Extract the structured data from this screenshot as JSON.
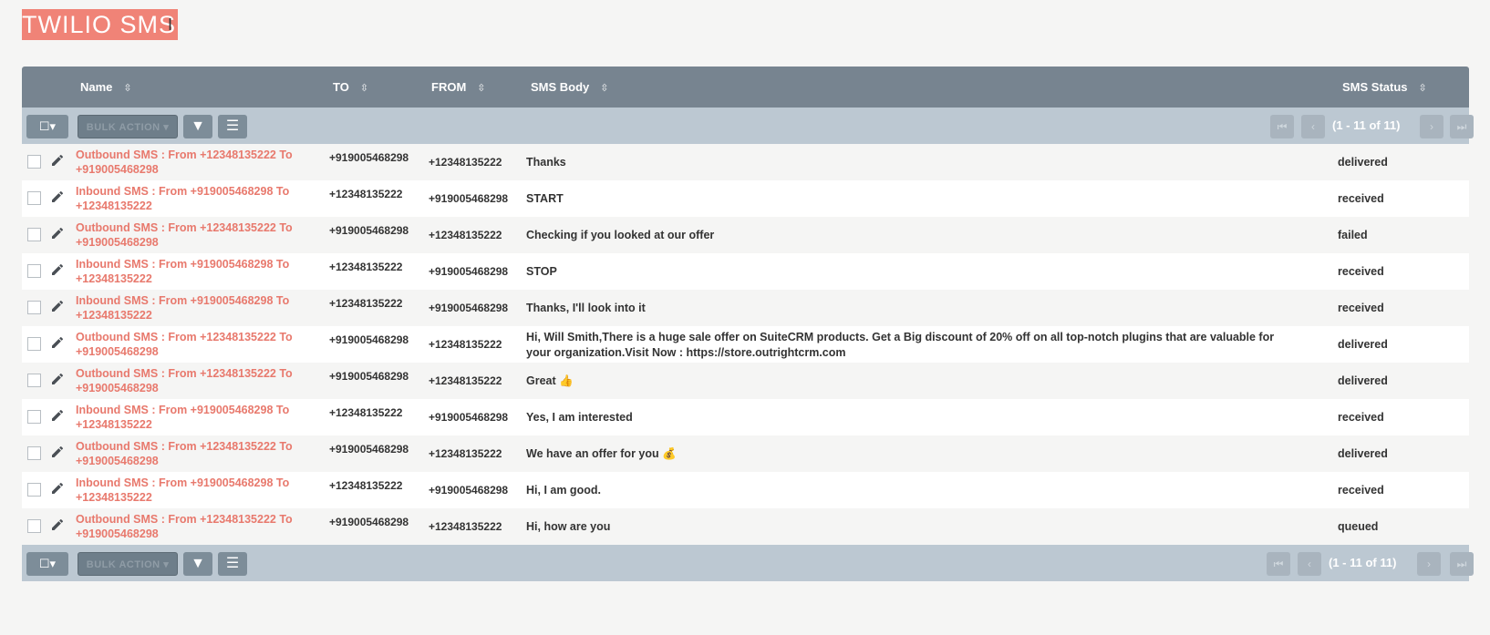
{
  "title": "TWILIO SMS",
  "columns": {
    "name": "Name",
    "to": "TO",
    "from": "FROM",
    "body": "SMS Body",
    "status": "SMS Status"
  },
  "toolbar": {
    "bulk_action": "BULK ACTION",
    "pagination": "(1 - 11 of 11)"
  },
  "rows": [
    {
      "name": "Outbound SMS : From +12348135222 To +919005468298",
      "to": "+919005468298",
      "from": "+12348135222",
      "body": "Thanks",
      "status": "delivered"
    },
    {
      "name": "Inbound SMS : From +919005468298 To +12348135222",
      "to": "+12348135222",
      "from": "+919005468298",
      "body": "START",
      "status": "received"
    },
    {
      "name": "Outbound SMS : From +12348135222 To +919005468298",
      "to": "+919005468298",
      "from": "+12348135222",
      "body": "Checking if you looked at our offer",
      "status": "failed"
    },
    {
      "name": "Inbound SMS : From +919005468298 To +12348135222",
      "to": "+12348135222",
      "from": "+919005468298",
      "body": "STOP",
      "status": "received"
    },
    {
      "name": "Inbound SMS : From +919005468298 To +12348135222",
      "to": "+12348135222",
      "from": "+919005468298",
      "body": "Thanks, I'll look into it",
      "status": "received"
    },
    {
      "name": "Outbound SMS : From +12348135222 To +919005468298",
      "to": "+919005468298",
      "from": "+12348135222",
      "body": "Hi, Will Smith,There is a huge sale offer on SuiteCRM products. Get a Big discount of 20% off on all top-notch plugins that are valuable for your organization.Visit Now : https://store.outrightcrm.com",
      "status": "delivered"
    },
    {
      "name": "Outbound SMS : From +12348135222 To +919005468298",
      "to": "+919005468298",
      "from": "+12348135222",
      "body": "Great 👍",
      "status": "delivered"
    },
    {
      "name": "Inbound SMS : From +919005468298 To +12348135222",
      "to": "+12348135222",
      "from": "+919005468298",
      "body": "Yes, I am interested",
      "status": "received"
    },
    {
      "name": "Outbound SMS : From +12348135222 To +919005468298",
      "to": "+919005468298",
      "from": "+12348135222",
      "body": "We have an offer for you 💰",
      "status": "delivered"
    },
    {
      "name": "Inbound SMS : From +919005468298 To +12348135222",
      "to": "+12348135222",
      "from": "+919005468298",
      "body": "Hi, I am good.",
      "status": "received"
    },
    {
      "name": "Outbound SMS : From +12348135222 To +919005468298",
      "to": "+919005468298",
      "from": "+12348135222",
      "body": "Hi, how are you",
      "status": "queued"
    }
  ]
}
